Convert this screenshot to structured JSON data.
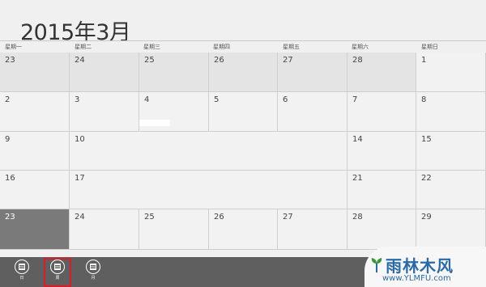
{
  "header": {
    "month_title": "2015年3月"
  },
  "weekdays": [
    "星期一",
    "星期二",
    "星期三",
    "星期四",
    "星期五",
    "星期六",
    "星期日"
  ],
  "weeks": [
    [
      "23",
      "24",
      "25",
      "26",
      "27",
      "28",
      "1"
    ],
    [
      "2",
      "3",
      "4",
      "5",
      "6",
      "7",
      "8"
    ],
    [
      "9",
      "10",
      "",
      "",
      "",
      "14",
      "15"
    ],
    [
      "16",
      "17",
      "",
      "",
      "",
      "21",
      "22"
    ],
    [
      "23",
      "24",
      "25",
      "26",
      "27",
      "28",
      "29"
    ],
    [
      "",
      "",
      "",
      "",
      "",
      "",
      ""
    ]
  ],
  "appbar": {
    "day_label": "日",
    "week_label": "周",
    "month_label": "月"
  },
  "watermark": {
    "text": "雨林木风",
    "url": "www.YLMFU.com"
  }
}
